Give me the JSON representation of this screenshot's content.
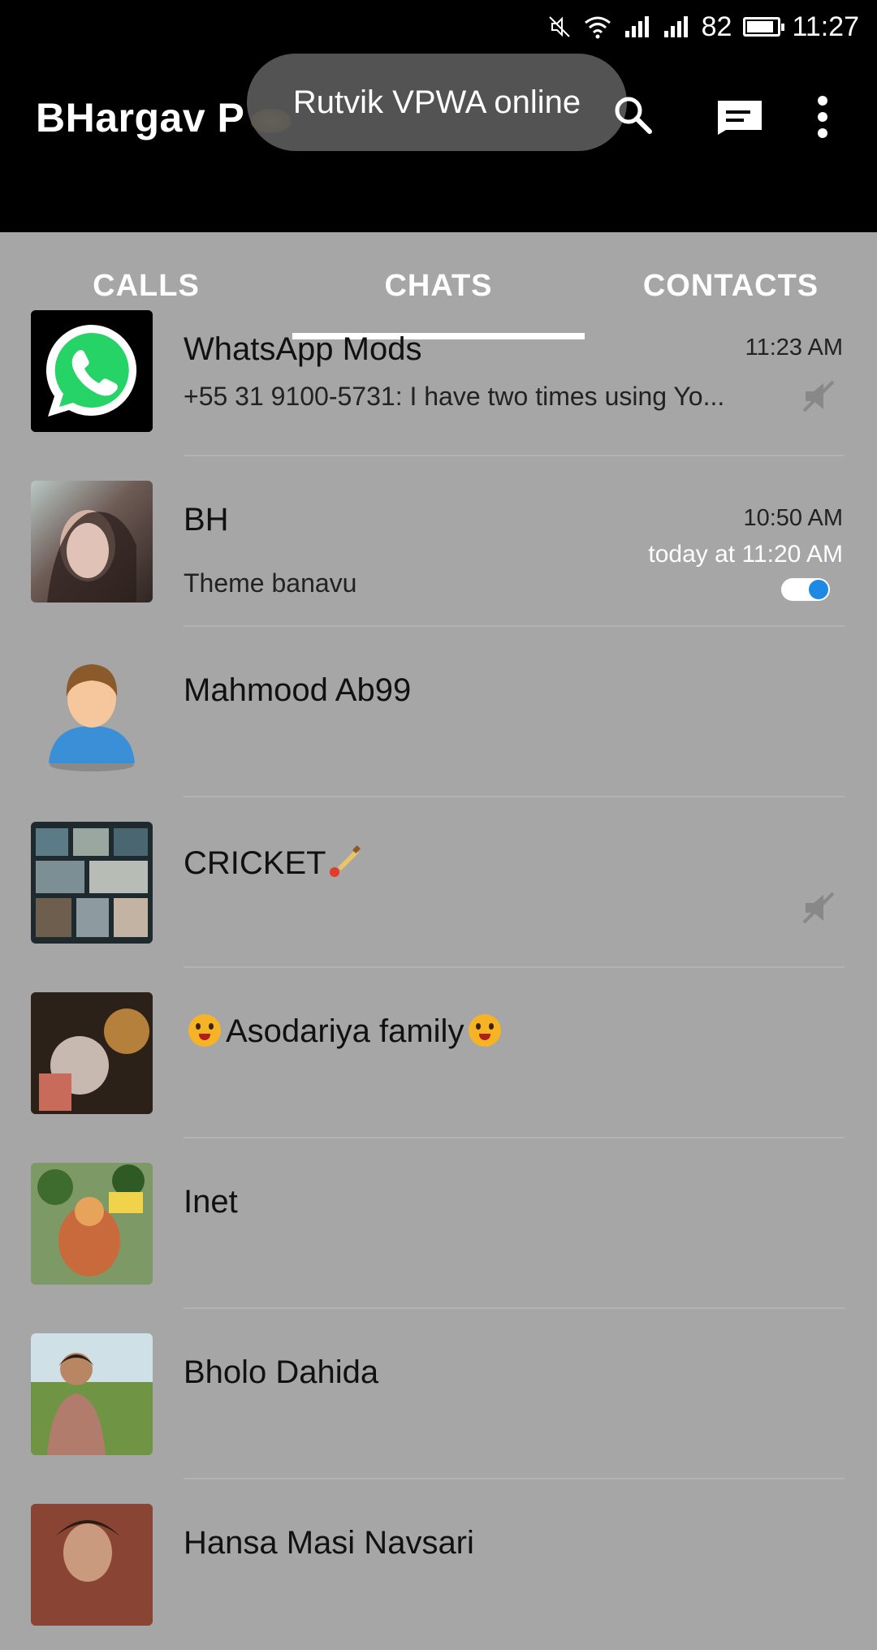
{
  "status_bar": {
    "battery": "82",
    "clock": "11:27"
  },
  "app_bar": {
    "title": "BHargav P",
    "toast": "Rutvik VPWA online"
  },
  "tabs": [
    {
      "label": "CALLS",
      "active": false
    },
    {
      "label": "CHATS",
      "active": true
    },
    {
      "label": "CONTACTS",
      "active": false
    }
  ],
  "chats": [
    {
      "name": "WhatsApp Mods",
      "message": "+55 31 9100-5731: I have two times using Yo...",
      "time": "11:23 AM",
      "muted": true
    },
    {
      "name": "BH",
      "message": "Theme banavu",
      "time": "10:50 AM",
      "subtime": "today at 11:20 AM",
      "toggle": true
    },
    {
      "name": "Mahmood Ab99",
      "message": "",
      "time": ""
    },
    {
      "name": "CRICKET",
      "message": "",
      "time": "",
      "muted": true
    },
    {
      "name": "Asodariya family",
      "message": "",
      "time": ""
    },
    {
      "name": "Inet",
      "message": "",
      "time": ""
    },
    {
      "name": "Bholo Dahida",
      "message": "",
      "time": ""
    },
    {
      "name": "Hansa Masi Navsari",
      "message": "",
      "time": ""
    }
  ],
  "colors": {
    "app_bar": "#000000",
    "list_background": "#a6a6a6",
    "toggle_accent": "#1e88e5",
    "whatsapp_green": "#25d366"
  }
}
